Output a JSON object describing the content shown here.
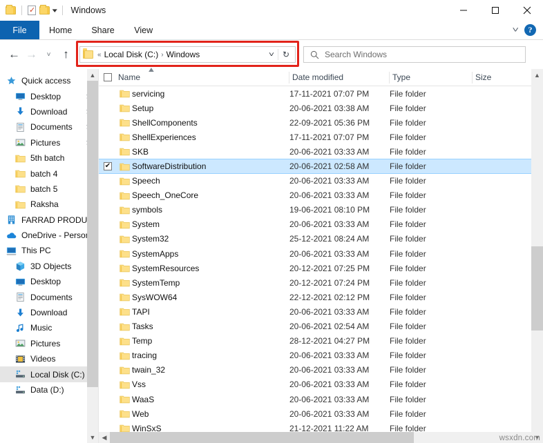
{
  "window": {
    "title": "Windows",
    "quick_access": [
      "folder-icon",
      "properties-icon",
      "new-folder-icon",
      "customize-caret"
    ],
    "controls": {
      "minimize": "minimize-icon",
      "maximize": "maximize-icon",
      "close": "close-icon"
    }
  },
  "ribbon": {
    "tabs": [
      {
        "label": "File",
        "active": true
      },
      {
        "label": "Home",
        "active": false
      },
      {
        "label": "Share",
        "active": false
      },
      {
        "label": "View",
        "active": false
      }
    ],
    "expand_label": "˅",
    "help_label": "?"
  },
  "toolbar": {
    "back": "←",
    "forward": "→",
    "recent": "˅",
    "up": "↑",
    "refresh": "↻",
    "dropdown": "˅"
  },
  "address": {
    "prefix": "«",
    "crumbs": [
      "Local Disk (C:)",
      "Windows"
    ],
    "separator": "›",
    "highlight_color": "#e2231a"
  },
  "search": {
    "placeholder": "Search Windows",
    "value": ""
  },
  "sidebar": {
    "items": [
      {
        "label": "Quick access",
        "icon": "star-icon",
        "indent": 0,
        "pinned": false,
        "selected": false
      },
      {
        "label": "Desktop",
        "icon": "desktop-icon",
        "indent": 1,
        "pinned": true,
        "selected": false
      },
      {
        "label": "Download",
        "icon": "download-icon",
        "indent": 1,
        "pinned": true,
        "selected": false
      },
      {
        "label": "Documents",
        "icon": "documents-icon",
        "indent": 1,
        "pinned": true,
        "selected": false
      },
      {
        "label": "Pictures",
        "icon": "pictures-icon",
        "indent": 1,
        "pinned": true,
        "selected": false
      },
      {
        "label": "5th batch",
        "icon": "folder-icon",
        "indent": 1,
        "pinned": false,
        "selected": false
      },
      {
        "label": "batch 4",
        "icon": "folder-icon",
        "indent": 1,
        "pinned": false,
        "selected": false
      },
      {
        "label": "batch 5",
        "icon": "folder-icon",
        "indent": 1,
        "pinned": false,
        "selected": false
      },
      {
        "label": "Raksha",
        "icon": "folder-icon",
        "indent": 1,
        "pinned": false,
        "selected": false
      },
      {
        "label": "FARRAD PRODUCT",
        "icon": "business-icon",
        "indent": 0,
        "pinned": false,
        "selected": false
      },
      {
        "label": "OneDrive - Personal",
        "icon": "onedrive-icon",
        "indent": 0,
        "pinned": false,
        "selected": false
      },
      {
        "label": "This PC",
        "icon": "thispc-icon",
        "indent": 0,
        "pinned": false,
        "selected": false
      },
      {
        "label": "3D Objects",
        "icon": "3dobjects-icon",
        "indent": 1,
        "pinned": false,
        "selected": false
      },
      {
        "label": "Desktop",
        "icon": "desktop-icon",
        "indent": 1,
        "pinned": false,
        "selected": false
      },
      {
        "label": "Documents",
        "icon": "documents-icon",
        "indent": 1,
        "pinned": false,
        "selected": false
      },
      {
        "label": "Download",
        "icon": "download-icon",
        "indent": 1,
        "pinned": false,
        "selected": false
      },
      {
        "label": "Music",
        "icon": "music-icon",
        "indent": 1,
        "pinned": false,
        "selected": false
      },
      {
        "label": "Pictures",
        "icon": "pictures-icon",
        "indent": 1,
        "pinned": false,
        "selected": false
      },
      {
        "label": "Videos",
        "icon": "videos-icon",
        "indent": 1,
        "pinned": false,
        "selected": false
      },
      {
        "label": "Local Disk (C:)",
        "icon": "drive-icon",
        "indent": 1,
        "pinned": false,
        "selected": true
      },
      {
        "label": "Data (D:)",
        "icon": "drive-icon",
        "indent": 1,
        "pinned": false,
        "selected": false
      }
    ]
  },
  "filelist": {
    "columns": [
      {
        "key": "name",
        "label": "Name",
        "sorted": "asc"
      },
      {
        "key": "date",
        "label": "Date modified",
        "sorted": null
      },
      {
        "key": "type",
        "label": "Type",
        "sorted": null
      },
      {
        "key": "size",
        "label": "Size",
        "sorted": null
      }
    ],
    "select_all_checked": false,
    "rows": [
      {
        "name": "servicing",
        "date": "17-11-2021 07:07 PM",
        "type": "File folder",
        "size": "",
        "selected": false
      },
      {
        "name": "Setup",
        "date": "20-06-2021 03:38 AM",
        "type": "File folder",
        "size": "",
        "selected": false
      },
      {
        "name": "ShellComponents",
        "date": "22-09-2021 05:36 PM",
        "type": "File folder",
        "size": "",
        "selected": false
      },
      {
        "name": "ShellExperiences",
        "date": "17-11-2021 07:07 PM",
        "type": "File folder",
        "size": "",
        "selected": false
      },
      {
        "name": "SKB",
        "date": "20-06-2021 03:33 AM",
        "type": "File folder",
        "size": "",
        "selected": false
      },
      {
        "name": "SoftwareDistribution",
        "date": "20-06-2021 02:58 AM",
        "type": "File folder",
        "size": "",
        "selected": true
      },
      {
        "name": "Speech",
        "date": "20-06-2021 03:33 AM",
        "type": "File folder",
        "size": "",
        "selected": false
      },
      {
        "name": "Speech_OneCore",
        "date": "20-06-2021 03:33 AM",
        "type": "File folder",
        "size": "",
        "selected": false
      },
      {
        "name": "symbols",
        "date": "19-06-2021 08:10 PM",
        "type": "File folder",
        "size": "",
        "selected": false
      },
      {
        "name": "System",
        "date": "20-06-2021 03:33 AM",
        "type": "File folder",
        "size": "",
        "selected": false
      },
      {
        "name": "System32",
        "date": "25-12-2021 08:24 AM",
        "type": "File folder",
        "size": "",
        "selected": false
      },
      {
        "name": "SystemApps",
        "date": "20-06-2021 03:33 AM",
        "type": "File folder",
        "size": "",
        "selected": false
      },
      {
        "name": "SystemResources",
        "date": "20-12-2021 07:25 PM",
        "type": "File folder",
        "size": "",
        "selected": false
      },
      {
        "name": "SystemTemp",
        "date": "20-12-2021 07:24 PM",
        "type": "File folder",
        "size": "",
        "selected": false
      },
      {
        "name": "SysWOW64",
        "date": "22-12-2021 02:12 PM",
        "type": "File folder",
        "size": "",
        "selected": false
      },
      {
        "name": "TAPI",
        "date": "20-06-2021 03:33 AM",
        "type": "File folder",
        "size": "",
        "selected": false
      },
      {
        "name": "Tasks",
        "date": "20-06-2021 02:54 AM",
        "type": "File folder",
        "size": "",
        "selected": false
      },
      {
        "name": "Temp",
        "date": "28-12-2021 04:27 PM",
        "type": "File folder",
        "size": "",
        "selected": false
      },
      {
        "name": "tracing",
        "date": "20-06-2021 03:33 AM",
        "type": "File folder",
        "size": "",
        "selected": false
      },
      {
        "name": "twain_32",
        "date": "20-06-2021 03:33 AM",
        "type": "File folder",
        "size": "",
        "selected": false
      },
      {
        "name": "Vss",
        "date": "20-06-2021 03:33 AM",
        "type": "File folder",
        "size": "",
        "selected": false
      },
      {
        "name": "WaaS",
        "date": "20-06-2021 03:33 AM",
        "type": "File folder",
        "size": "",
        "selected": false
      },
      {
        "name": "Web",
        "date": "20-06-2021 03:33 AM",
        "type": "File folder",
        "size": "",
        "selected": false
      },
      {
        "name": "WinSxS",
        "date": "21-12-2021 11:22 AM",
        "type": "File folder",
        "size": "",
        "selected": false
      }
    ]
  },
  "watermark": "wsxdn.com"
}
